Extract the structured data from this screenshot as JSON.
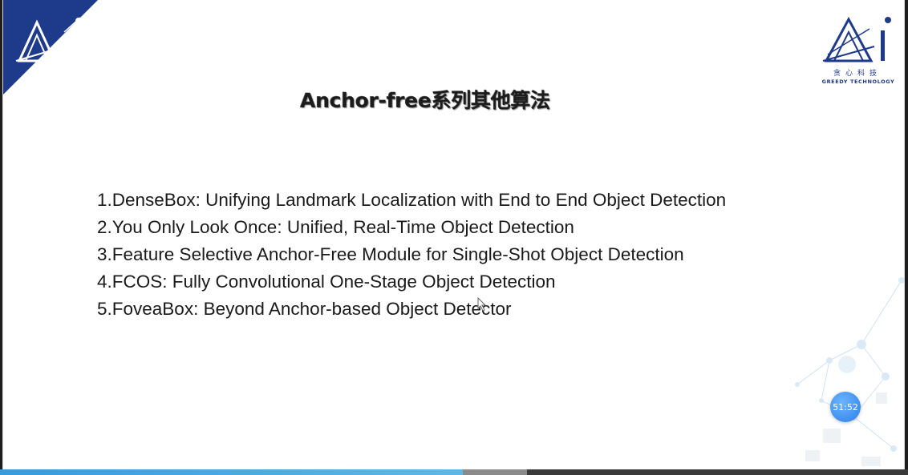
{
  "slide": {
    "title": "Anchor-free系列其他算法",
    "logo_left": {
      "icon": "ai-logo-icon",
      "color": "#1e3a8a"
    },
    "logo_right": {
      "icon": "ai-logo-icon",
      "brand_cn": "贪心科技",
      "brand_en": "GREEDY TECHNOLOGY",
      "color": "#1e3a8a"
    },
    "papers": [
      "1.DenseBox: Unifying Landmark Localization with End to End Object Detection",
      "2.You Only Look Once: Unified, Real-Time Object Detection",
      "3.Feature Selective Anchor-Free Module for Single-Shot Object Detection",
      "4.FCOS: Fully Convolutional One-Stage Object Detection",
      "5.FoveaBox: Beyond Anchor-based Object Detector"
    ]
  },
  "player": {
    "timer": "51:52",
    "progress_fraction": 0.51,
    "buffered_fraction": 0.58,
    "accent_color": "#3b9ad8"
  }
}
